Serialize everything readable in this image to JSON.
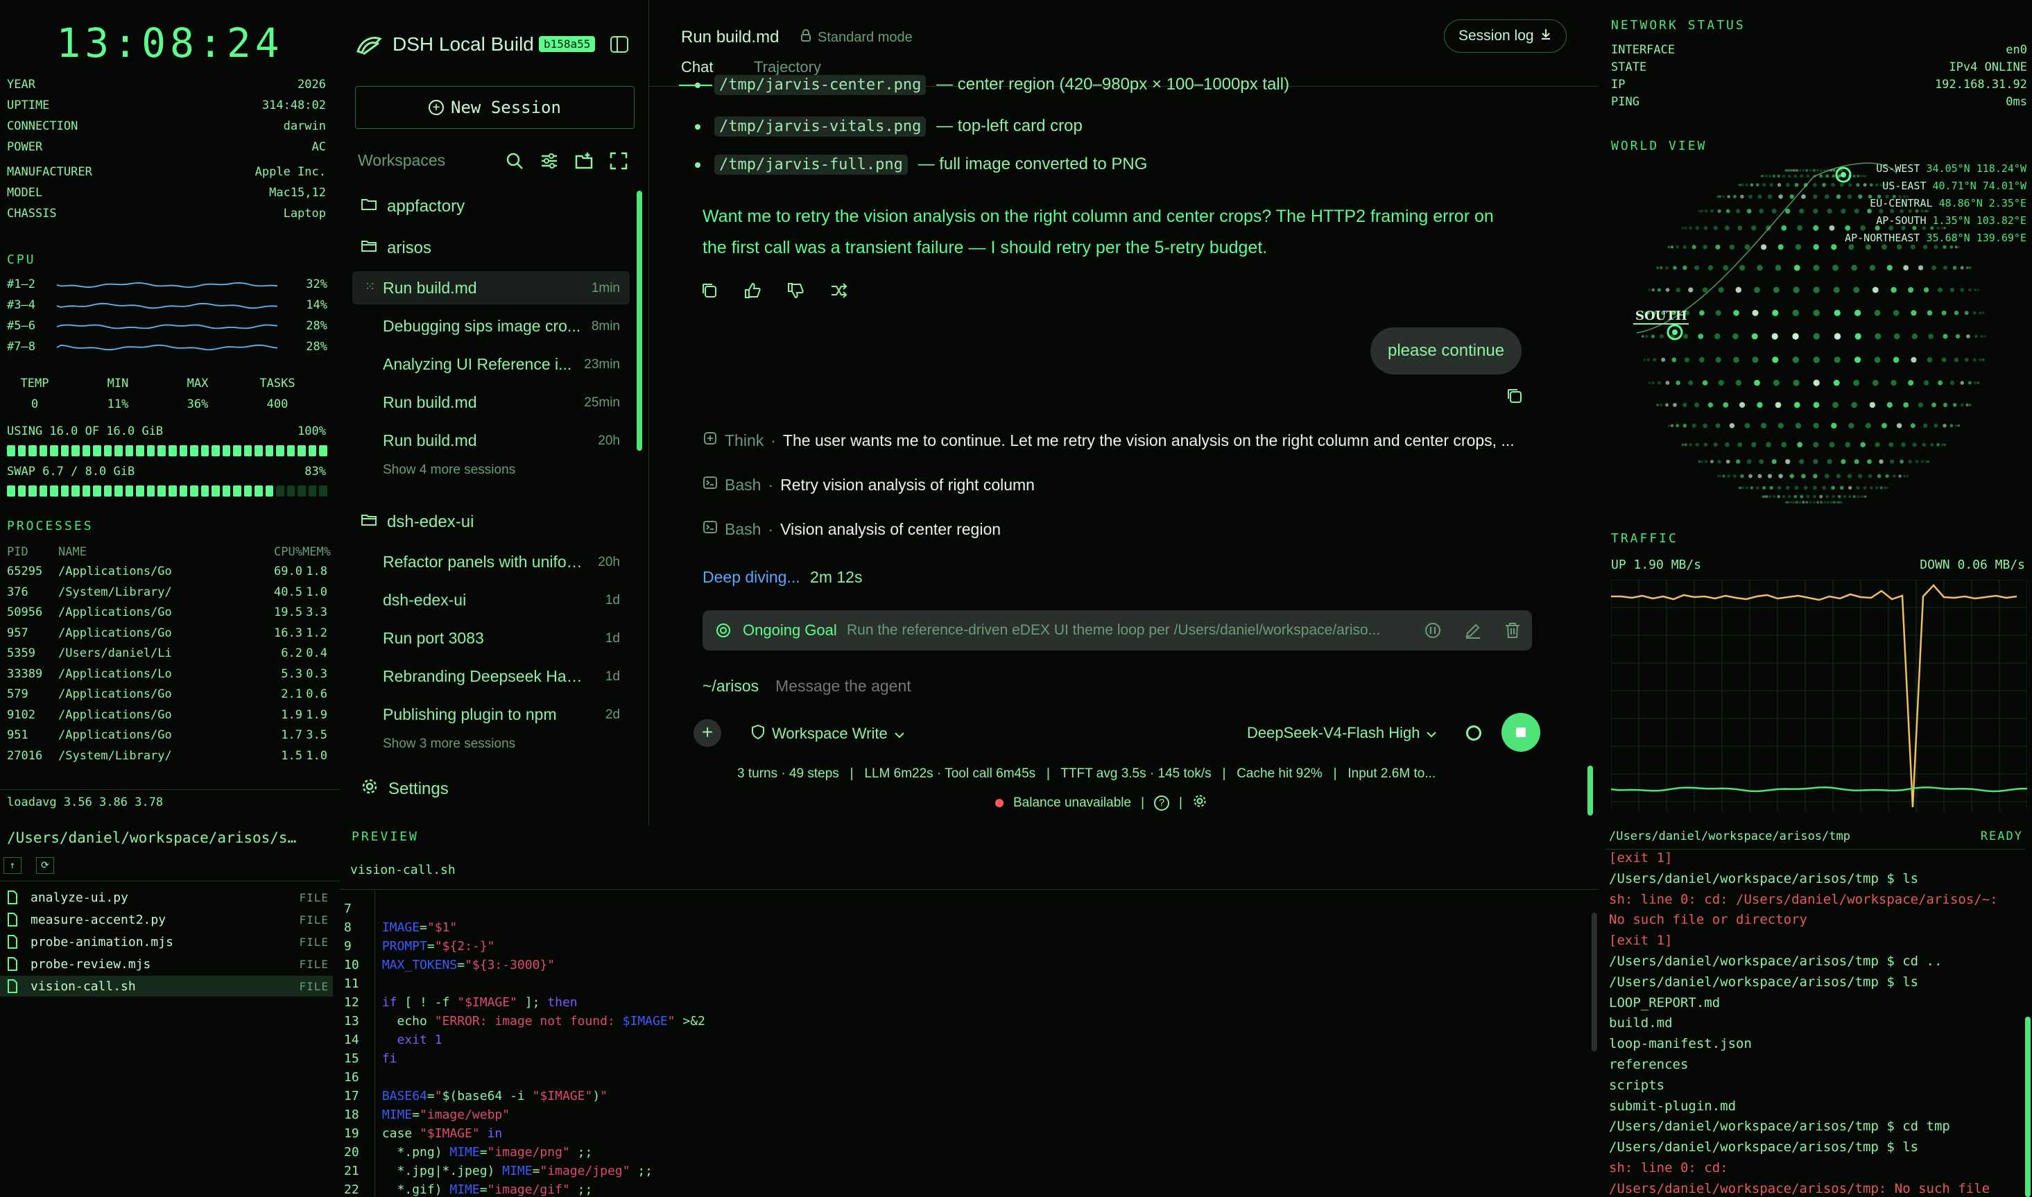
{
  "system": {
    "clock": "13:08:24",
    "info": [
      {
        "k": "YEAR",
        "v": "2026"
      },
      {
        "k": "UPTIME",
        "v": "314:48:02"
      },
      {
        "k": "CONNECTION",
        "v": "darwin"
      },
      {
        "k": "POWER",
        "v": "AC"
      },
      {
        "k": "MANUFACTURER",
        "v": "Apple Inc."
      },
      {
        "k": "MODEL",
        "v": "Mac15,12"
      },
      {
        "k": "CHASSIS",
        "v": "Laptop"
      }
    ],
    "cpu_title": "CPU",
    "cpu": [
      {
        "label": "#1–2",
        "pct": "32%"
      },
      {
        "label": "#3–4",
        "pct": "14%"
      },
      {
        "label": "#5–6",
        "pct": "28%"
      },
      {
        "label": "#7–8",
        "pct": "28%"
      }
    ],
    "stats_labels": [
      "TEMP",
      "MIN",
      "MAX",
      "TASKS"
    ],
    "stats_values": [
      "0",
      "11%",
      "36%",
      "400"
    ],
    "mem_label": "USING 16.0 OF 16.0 GiB",
    "mem_pct": "100%",
    "mem_fill": 1.0,
    "swap_label": "SWAP 6.7 / 8.0 GiB",
    "swap_pct": "83%",
    "swap_fill": 0.83,
    "proc_title": "PROCESSES",
    "proc_headers": [
      "PID",
      "NAME",
      "CPU%",
      "MEM%"
    ],
    "processes": [
      [
        "65295",
        "/Applications/Go",
        "69.0",
        "1.8"
      ],
      [
        "376",
        "/System/Library/",
        "40.5",
        "1.0"
      ],
      [
        "50956",
        "/Applications/Go",
        "19.5",
        "3.3"
      ],
      [
        "957",
        "/Applications/Go",
        "16.3",
        "1.2"
      ],
      [
        "5359",
        "/Users/daniel/Li",
        "6.2",
        "0.4"
      ],
      [
        "33389",
        "/Applications/Lo",
        "5.3",
        "0.3"
      ],
      [
        "579",
        "/Applications/Go",
        "2.1",
        "0.6"
      ],
      [
        "9102",
        "/Applications/Go",
        "1.9",
        "1.9"
      ],
      [
        "951",
        "/Applications/Go",
        "1.7",
        "3.5"
      ],
      [
        "27016",
        "/System/Library/",
        "1.5",
        "1.0"
      ]
    ],
    "loadavg": "loadavg 3.56 3.86 3.78"
  },
  "sidebar": {
    "app_title": "DSH Local Build",
    "badge": "b158a55",
    "new_session": "New Session",
    "workspaces_label": "Workspaces",
    "groups": [
      {
        "name": "appfactory",
        "open": false,
        "sessions": []
      },
      {
        "name": "arisos",
        "open": true,
        "sessions": [
          {
            "title": "Run build.md",
            "age": "1min",
            "active": true
          },
          {
            "title": "Debugging sips image cro...",
            "age": "8min"
          },
          {
            "title": "Analyzing UI Reference i...",
            "age": "23min"
          },
          {
            "title": "Run build.md",
            "age": "25min"
          },
          {
            "title": "Run build.md",
            "age": "20h"
          }
        ],
        "more": "Show 4 more sessions"
      },
      {
        "name": "dsh-edex-ui",
        "open": true,
        "sessions": [
          {
            "title": "Refactor panels with unifor...",
            "age": "20h"
          },
          {
            "title": "dsh-edex-ui",
            "age": "1d"
          },
          {
            "title": "Run port 3083",
            "age": "1d"
          },
          {
            "title": "Rebranding Deepseek Harn...",
            "age": "1d"
          },
          {
            "title": "Publishing plugin to npm",
            "age": "2d"
          }
        ],
        "more": "Show 3 more sessions"
      }
    ],
    "settings": "Settings"
  },
  "chat": {
    "title": "Run build.md",
    "mode": "Standard mode",
    "session_log": "Session log",
    "tabs": [
      "Chat",
      "Trajectory"
    ],
    "bullets": [
      {
        "code": "/tmp/jarvis-center.png",
        "text": "— center region (420–980px × 100–1000px tall)"
      },
      {
        "code": "/tmp/jarvis-vitals.png",
        "text": "— top-left card crop"
      },
      {
        "code": "/tmp/jarvis-full.png",
        "text": "— full image converted to PNG"
      }
    ],
    "assistant_line1": "Want me to retry the vision analysis on the right column and center crops? The HTTP2 framing error on",
    "assistant_line2": "the first call was a transient failure — I should retry per the 5-retry budget.",
    "user_message": "please continue",
    "steps": [
      {
        "kind": "Think",
        "text": "The user wants me to continue. Let me retry the vision analysis on the right column and center crops, ..."
      },
      {
        "kind": "Bash",
        "text": "Retry vision analysis of right column"
      },
      {
        "kind": "Bash",
        "text": "Vision analysis of center region"
      }
    ],
    "deep_diving": "Deep diving...",
    "deep_time": "2m 12s",
    "goal_label": "Ongoing Goal",
    "goal_text": "Run the reference-driven eDEX UI theme loop per /Users/daniel/workspace/ariso...",
    "cwd": "~/arisos",
    "input_placeholder": "Message the agent",
    "workspace_write": "Workspace Write",
    "model": "DeepSeek-V4-Flash High",
    "stats": "3 turns · 49 steps   |   LLM 6m22s · Tool call 6m45s   |   TTFT avg 3.5s · 145 tok/s   |   Cache hit 92%   |   Input 2.6M to...",
    "balance": "Balance unavailable"
  },
  "network": {
    "title": "NETWORK STATUS",
    "rows": [
      {
        "k": "INTERFACE",
        "v": "en0"
      },
      {
        "k": "STATE",
        "v": "IPv4 ONLINE"
      },
      {
        "k": "IP",
        "v": "192.168.31.92"
      },
      {
        "k": "PING",
        "v": "0ms"
      }
    ],
    "world_title": "WORLD VIEW",
    "locations": [
      {
        "name": "US-WEST",
        "coord": "34.05°N 118.24°W"
      },
      {
        "name": "US-EAST",
        "coord": "40.71°N 74.01°W"
      },
      {
        "name": "EU-CENTRAL",
        "coord": "48.86°N 2.35°E"
      },
      {
        "name": "AP-SOUTH",
        "coord": "1.35°N 103.82°E"
      },
      {
        "name": "AP-NORTHEAST",
        "coord": "35.68°N 139.69°E"
      }
    ],
    "south_label": "SOUTH",
    "traffic_title": "TRAFFIC",
    "up": "UP 1.90 MB/s",
    "down": "DOWN 0.06 MB/s"
  },
  "files": {
    "path": "/Users/daniel/workspace/arisos/s…",
    "items": [
      {
        "name": "analyze-ui.py",
        "type": "FILE"
      },
      {
        "name": "measure-accent2.py",
        "type": "FILE"
      },
      {
        "name": "probe-animation.mjs",
        "type": "FILE"
      },
      {
        "name": "probe-review.mjs",
        "type": "FILE"
      },
      {
        "name": "vision-call.sh",
        "type": "FILE",
        "active": true
      }
    ]
  },
  "preview": {
    "title": "PREVIEW",
    "filename": "vision-call.sh"
  },
  "terminal": {
    "path": "/Users/daniel/workspace/arisos/tmp",
    "status": "READY",
    "lines": [
      {
        "t": "[exit 1]",
        "c": "err"
      },
      {
        "t": "/Users/daniel/workspace/arisos/tmp $ ls",
        "c": "ok"
      },
      {
        "t": "sh: line 0: cd: /Users/daniel/workspace/arisos/~:",
        "c": "err"
      },
      {
        "t": "No such file or directory",
        "c": "err"
      },
      {
        "t": "[exit 1]",
        "c": "err"
      },
      {
        "t": "/Users/daniel/workspace/arisos/tmp $ cd ..",
        "c": "ok"
      },
      {
        "t": "/Users/daniel/workspace/arisos/tmp $ ls",
        "c": "ok"
      },
      {
        "t": "LOOP_REPORT.md",
        "c": "ok"
      },
      {
        "t": "build.md",
        "c": "ok"
      },
      {
        "t": "loop-manifest.json",
        "c": "ok"
      },
      {
        "t": "references",
        "c": "ok"
      },
      {
        "t": "scripts",
        "c": "ok"
      },
      {
        "t": "submit-plugin.md",
        "c": "ok"
      },
      {
        "t": "/Users/daniel/workspace/arisos/tmp $ cd tmp",
        "c": "ok"
      },
      {
        "t": "/Users/daniel/workspace/arisos/tmp $ ls",
        "c": "ok"
      },
      {
        "t": "sh: line 0: cd:",
        "c": "err"
      },
      {
        "t": "/Users/daniel/workspace/arisos/tmp: No such file",
        "c": "err"
      }
    ]
  }
}
